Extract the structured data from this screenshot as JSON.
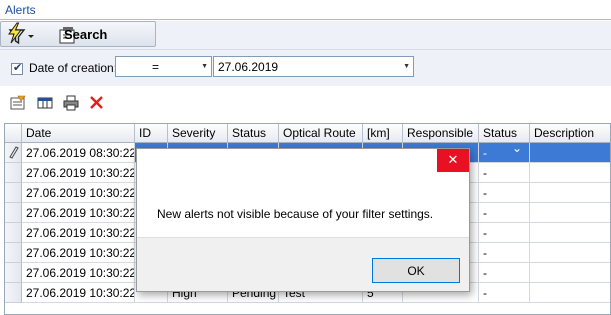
{
  "window": {
    "title": "Alerts"
  },
  "toolbar": {
    "search_label": "Search"
  },
  "filter": {
    "checkbox_checked": true,
    "label": "Date of creation:",
    "operator": "=",
    "date": "27.06.2019"
  },
  "grid": {
    "columns": [
      "Date",
      "ID",
      "Severity",
      "Status",
      "Optical Route",
      "[km]",
      "Responsible",
      "Status",
      "Description"
    ],
    "rows": [
      {
        "date": "27.06.2019 08:30:22",
        "id": "",
        "severity": "",
        "status": "",
        "route": "",
        "km": "",
        "responsible": "",
        "status2": "-",
        "description": ""
      },
      {
        "date": "27.06.2019 10:30:22",
        "id": "",
        "severity": "",
        "status": "",
        "route": "",
        "km": "",
        "responsible": "",
        "status2": "-",
        "description": ""
      },
      {
        "date": "27.06.2019 10:30:22",
        "id": "",
        "severity": "",
        "status": "",
        "route": "",
        "km": "",
        "responsible": "",
        "status2": "-",
        "description": ""
      },
      {
        "date": "27.06.2019 10:30:22",
        "id": "",
        "severity": "",
        "status": "",
        "route": "",
        "km": "",
        "responsible": "",
        "status2": "-",
        "description": ""
      },
      {
        "date": "27.06.2019 10:30:22",
        "id": "",
        "severity": "",
        "status": "",
        "route": "",
        "km": "",
        "responsible": "",
        "status2": "-",
        "description": ""
      },
      {
        "date": "27.06.2019 10:30:22",
        "id": "",
        "severity": "",
        "status": "",
        "route": "",
        "km": "",
        "responsible": "",
        "status2": "-",
        "description": ""
      },
      {
        "date": "27.06.2019 10:30:22",
        "id": "",
        "severity": "",
        "status": "",
        "route": "",
        "km": "",
        "responsible": "",
        "status2": "-",
        "description": ""
      },
      {
        "date": "27.06.2019 10:30:22",
        "id": "",
        "severity": "High",
        "status": "Pending",
        "route": "Test",
        "km": "5",
        "responsible": "",
        "status2": "-",
        "description": ""
      }
    ]
  },
  "dialog": {
    "close_glyph": "✕",
    "message": "New alerts not visible because of your filter settings.",
    "ok_label": "OK"
  },
  "colors": {
    "selection": "#3d7ad6",
    "dialog_close": "#e81123",
    "title_text": "#1f4e9c"
  }
}
